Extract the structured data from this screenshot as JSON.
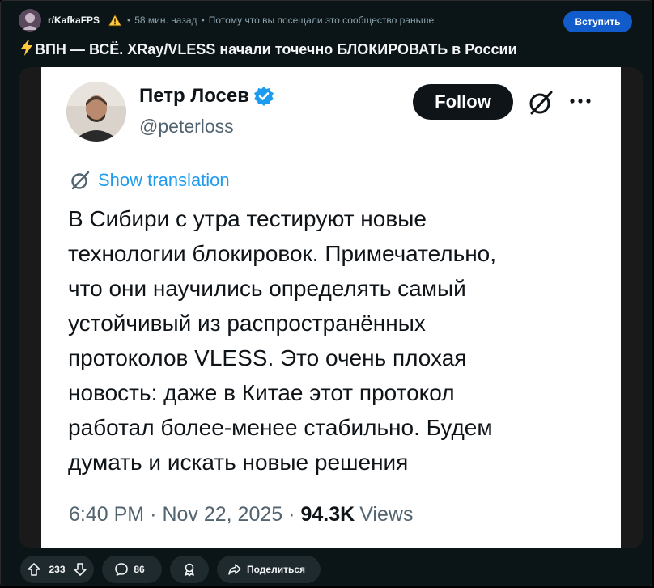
{
  "post": {
    "subreddit": "r/KafkaFPS",
    "time_ago": "58 мин. назад",
    "reason": "Потому что вы посещали это сообщество раньше",
    "join_label": "Вступить",
    "title": "ВПН — ВСЁ. XRay/VLESS начали точечно БЛОКИРОВАТЬ в России"
  },
  "tweet": {
    "name": "Петр Лосев",
    "handle": "@peterloss",
    "follow_label": "Follow",
    "translate_label": "Show translation",
    "text_lines": [
      "В Сибири с утра тестируют новые",
      "технологии блокировок. Примечательно,",
      "что они научились определять самый",
      "устойчивый из распространённых",
      "протоколов VLESS. Это очень плохая",
      "новость: даже в Китае этот протокол",
      "работал более-менее стабильно. Будем",
      "думать и искать новые решения"
    ],
    "time": "6:40 PM",
    "date": "Nov 22, 2025",
    "views_count": "94.3K",
    "views_label": "Views"
  },
  "actions": {
    "upvotes": "233",
    "comments": "86",
    "share_label": "Поделиться"
  },
  "colors": {
    "background": "#0b1416",
    "join_button": "#115bca",
    "link_blue": "#1d9bf0",
    "warning_yellow": "#ffc83d"
  }
}
